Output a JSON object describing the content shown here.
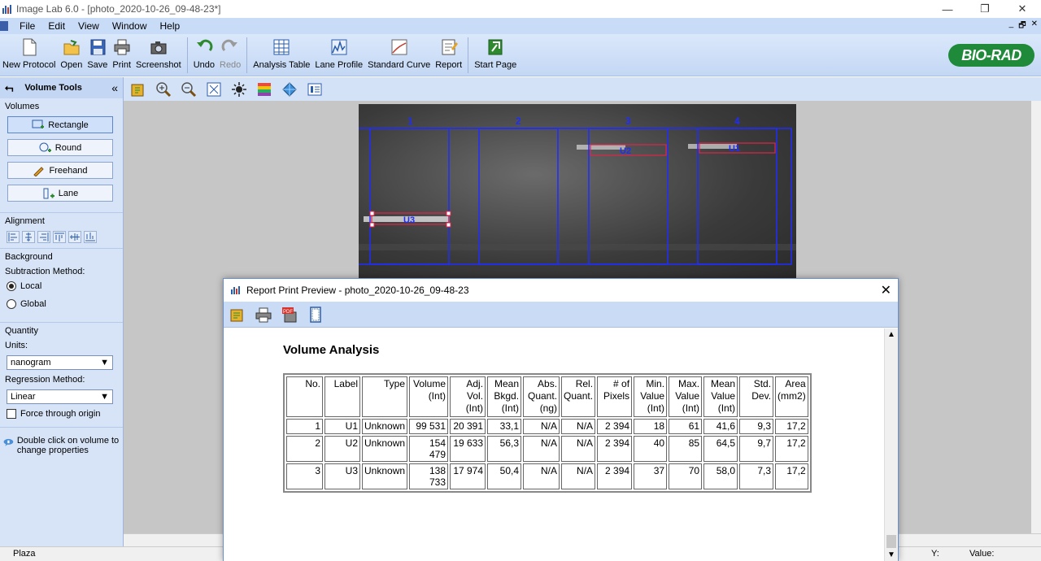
{
  "window": {
    "title": "Image Lab 6.0 - [photo_2020-10-26_09-48-23*]",
    "controls": [
      "—",
      "❐",
      "✕"
    ]
  },
  "menu": {
    "items": [
      "File",
      "Edit",
      "View",
      "Window",
      "Help"
    ],
    "mdi": [
      "_",
      "🗗",
      "✕"
    ]
  },
  "toolbar": {
    "new_protocol": "New Protocol",
    "open": "Open",
    "save": "Save",
    "print": "Print",
    "screenshot": "Screenshot",
    "undo": "Undo",
    "redo": "Redo",
    "analysis_table": "Analysis Table",
    "lane_profile": "Lane Profile",
    "standard_curve": "Standard Curve",
    "report": "Report",
    "start_page": "Start Page",
    "brand": "BIO-RAD"
  },
  "left_panel": {
    "back_glyph": "⮢",
    "title": "Volume Tools",
    "collapse_glyph": "«",
    "volumes": {
      "title": "Volumes",
      "rectangle": "Rectangle",
      "round": "Round",
      "freehand": "Freehand",
      "lane": "Lane"
    },
    "alignment": {
      "title": "Alignment"
    },
    "background": {
      "title": "Background",
      "subtraction_label": "Subtraction Method:",
      "local": "Local",
      "global": "Global"
    },
    "quantity": {
      "title": "Quantity",
      "units_label": "Units:",
      "units_value": "nanogram",
      "regression_label": "Regression Method:",
      "regression_value": "Linear",
      "force_origin": "Force through origin"
    },
    "hint": "Double click on volume to change properties"
  },
  "gel": {
    "lanes": [
      "1",
      "2",
      "3",
      "4"
    ],
    "bands": [
      "U3",
      "U2",
      "U1"
    ]
  },
  "statusbar": {
    "left": "Plaza",
    "y_label": "Y:",
    "value_label": "Value:"
  },
  "dialog": {
    "title": "Report Print Preview - photo_2020-10-26_09-48-23",
    "close": "✕",
    "report_title": "Volume Analysis",
    "headers": [
      "No.",
      "Label",
      "Type",
      "Volume (Int)",
      "Adj. Vol. (Int)",
      "Mean Bkgd. (Int)",
      "Abs. Quant. (ng)",
      "Rel. Quant.",
      "# of Pixels",
      "Min. Value (Int)",
      "Max. Value (Int)",
      "Mean Value (Int)",
      "Std. Dev.",
      "Area (mm2)"
    ],
    "rows": [
      [
        "1",
        "U1",
        "Unknown",
        "99 531",
        "20 391",
        "33,1",
        "N/A",
        "N/A",
        "2 394",
        "18",
        "61",
        "41,6",
        "9,3",
        "17,2"
      ],
      [
        "2",
        "U2",
        "Unknown",
        "154 479",
        "19 633",
        "56,3",
        "N/A",
        "N/A",
        "2 394",
        "40",
        "85",
        "64,5",
        "9,7",
        "17,2"
      ],
      [
        "3",
        "U3",
        "Unknown",
        "138 733",
        "17 974",
        "50,4",
        "N/A",
        "N/A",
        "2 394",
        "37",
        "70",
        "58,0",
        "7,3",
        "17,2"
      ]
    ]
  }
}
